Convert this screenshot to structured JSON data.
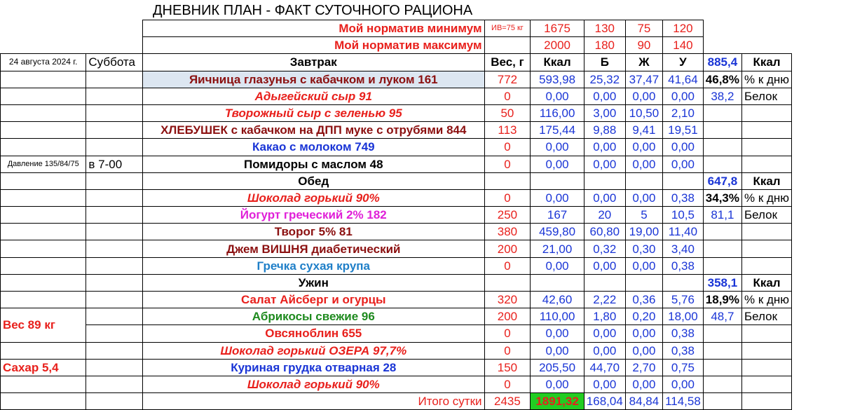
{
  "title": "ДНЕВНИК ПЛАН - ФАКТ СУТОЧНОГО РАЦИОНА",
  "norm_min": {
    "label": "Мой норматив минимум",
    "iv": "ИВ=75 кг",
    "kcal": "1675",
    "b": "130",
    "zh": "75",
    "u": "120"
  },
  "norm_max": {
    "label": "Мой норматив максимум",
    "kcal": "2000",
    "b": "180",
    "zh": "90",
    "u": "140"
  },
  "date": "24 августа 2024 г.",
  "weekday": "Суббота",
  "headers": {
    "meal": "Завтрак",
    "weight": "Вес, г",
    "kcal": "Ккал",
    "b": "Б",
    "zh": "Ж",
    "u": "У"
  },
  "side": {
    "pressure": "Давление 135/84/75",
    "time": "в 7-00",
    "weight": "Вес 89 кг",
    "sugar": "Сахар 5,4"
  },
  "summary": {
    "breakfast": {
      "kcal": "885,4",
      "kcal_unit": "Ккал",
      "pct": "46,8%",
      "pct_unit": "% к дню",
      "protein": "38,2",
      "protein_unit": "Белок"
    },
    "lunch": {
      "kcal": "647,8",
      "kcal_unit": "Ккал",
      "pct": "34,3%",
      "pct_unit": "% к дню",
      "protein": "81,1",
      "protein_unit": "Белок"
    },
    "dinner": {
      "kcal": "358,1",
      "kcal_unit": "Ккал",
      "pct": "18,9%",
      "pct_unit": "% к дню",
      "protein": "48,7",
      "protein_unit": "Белок"
    }
  },
  "sections": {
    "lunch": "Обед",
    "dinner": "Ужин"
  },
  "rows": [
    {
      "name": "Яичница глазунья с кабачком и луком 161",
      "w": "772",
      "kcal": "593,98",
      "b": "25,32",
      "zh": "37,47",
      "u": "41,64"
    },
    {
      "name": "Адыгейский сыр 91",
      "w": "0",
      "kcal": "0,00",
      "b": "0,00",
      "zh": "0,00",
      "u": "0,00"
    },
    {
      "name": "Творожный сыр с зеленью 95",
      "w": "50",
      "kcal": "116,00",
      "b": "3,00",
      "zh": "10,50",
      "u": "2,10"
    },
    {
      "name": "ХЛЕБУШЕК с кабачком на ДПП муке с отрубями 844",
      "w": "113",
      "kcal": "175,44",
      "b": "9,88",
      "zh": "9,41",
      "u": "19,51"
    },
    {
      "name": "Какао с молоком 749",
      "w": "0",
      "kcal": "0,00",
      "b": "0,00",
      "zh": "0,00",
      "u": "0,00"
    },
    {
      "name": "Помидоры с маслом 48",
      "w": "0",
      "kcal": "0,00",
      "b": "0,00",
      "zh": "0,00",
      "u": "0,00"
    },
    {
      "name": "Шоколад горький 90%",
      "w": "0",
      "kcal": "0,00",
      "b": "0,00",
      "zh": "0,00",
      "u": "0,38"
    },
    {
      "name": "Йогурт греческий 2% 182",
      "w": "250",
      "kcal": "167",
      "b": "20",
      "zh": "5",
      "u": "10,5"
    },
    {
      "name": "Творог 5% 81",
      "w": "380",
      "kcal": "459,80",
      "b": "60,80",
      "zh": "19,00",
      "u": "11,40"
    },
    {
      "name": "Джем ВИШНЯ диабетический",
      "w": "200",
      "kcal": "21,00",
      "b": "0,32",
      "zh": "0,30",
      "u": "3,40"
    },
    {
      "name": "Гречка сухая крупа",
      "w": "0",
      "kcal": "0,00",
      "b": "0,00",
      "zh": "0,00",
      "u": "0,38"
    },
    {
      "name": "Салат Айсберг и огурцы",
      "w": "320",
      "kcal": "42,60",
      "b": "2,22",
      "zh": "0,36",
      "u": "5,76"
    },
    {
      "name": "Абрикосы свежие 96",
      "w": "200",
      "kcal": "110,00",
      "b": "1,80",
      "zh": "0,20",
      "u": "18,00"
    },
    {
      "name": "Овсяноблин 655",
      "w": "0",
      "kcal": "0,00",
      "b": "0,00",
      "zh": "0,00",
      "u": "0,38"
    },
    {
      "name": "Шоколад горький ОЗЕРА 97,7%",
      "w": "0",
      "kcal": "0,00",
      "b": "0,00",
      "zh": "0,00",
      "u": "0,38"
    },
    {
      "name": "Куриная грудка отварная 28",
      "w": "150",
      "kcal": "205,50",
      "b": "44,70",
      "zh": "2,70",
      "u": "0,75"
    },
    {
      "name": "Шоколад горький 90%",
      "w": "0",
      "kcal": "0,00",
      "b": "0,00",
      "zh": "0,00",
      "u": "0,00"
    }
  ],
  "total": {
    "label": "Итого сутки",
    "w": "2435",
    "kcal": "1891,32",
    "b": "168,04",
    "zh": "84,84",
    "u": "114,58"
  }
}
